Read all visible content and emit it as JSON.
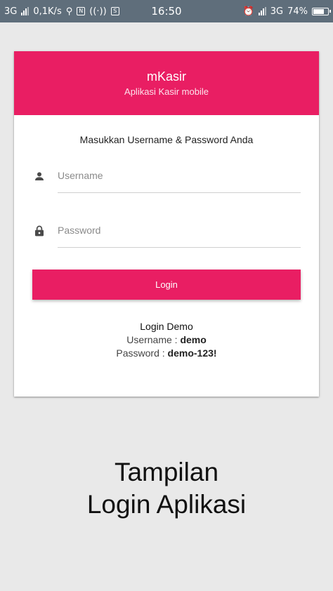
{
  "status_bar": {
    "network_left": "3G",
    "speed": "0,1K/s",
    "time": "16:50",
    "network_right": "3G",
    "battery": "74%",
    "icons": [
      "signal-icon",
      "usb-icon",
      "nfc-icon",
      "wifi-calling-icon",
      "s-icon",
      "alarm-icon",
      "signal-icon",
      "battery-icon"
    ]
  },
  "card": {
    "header": {
      "title": "mKasir",
      "subtitle": "Aplikasi Kasir mobile",
      "color": "#e91e63"
    },
    "instruction": "Masukkan Username & Password Anda",
    "username": {
      "placeholder": "Username",
      "value": "",
      "icon": "person-icon"
    },
    "password": {
      "placeholder": "Password",
      "value": "",
      "icon": "lock-icon"
    },
    "login_button": "Login",
    "demo": {
      "title": "Login Demo",
      "username_label": "Username : ",
      "username_value": "demo",
      "password_label": "Password : ",
      "password_value": "demo-123!"
    }
  },
  "caption": {
    "line1": "Tampilan",
    "line2": "Login Aplikasi"
  }
}
